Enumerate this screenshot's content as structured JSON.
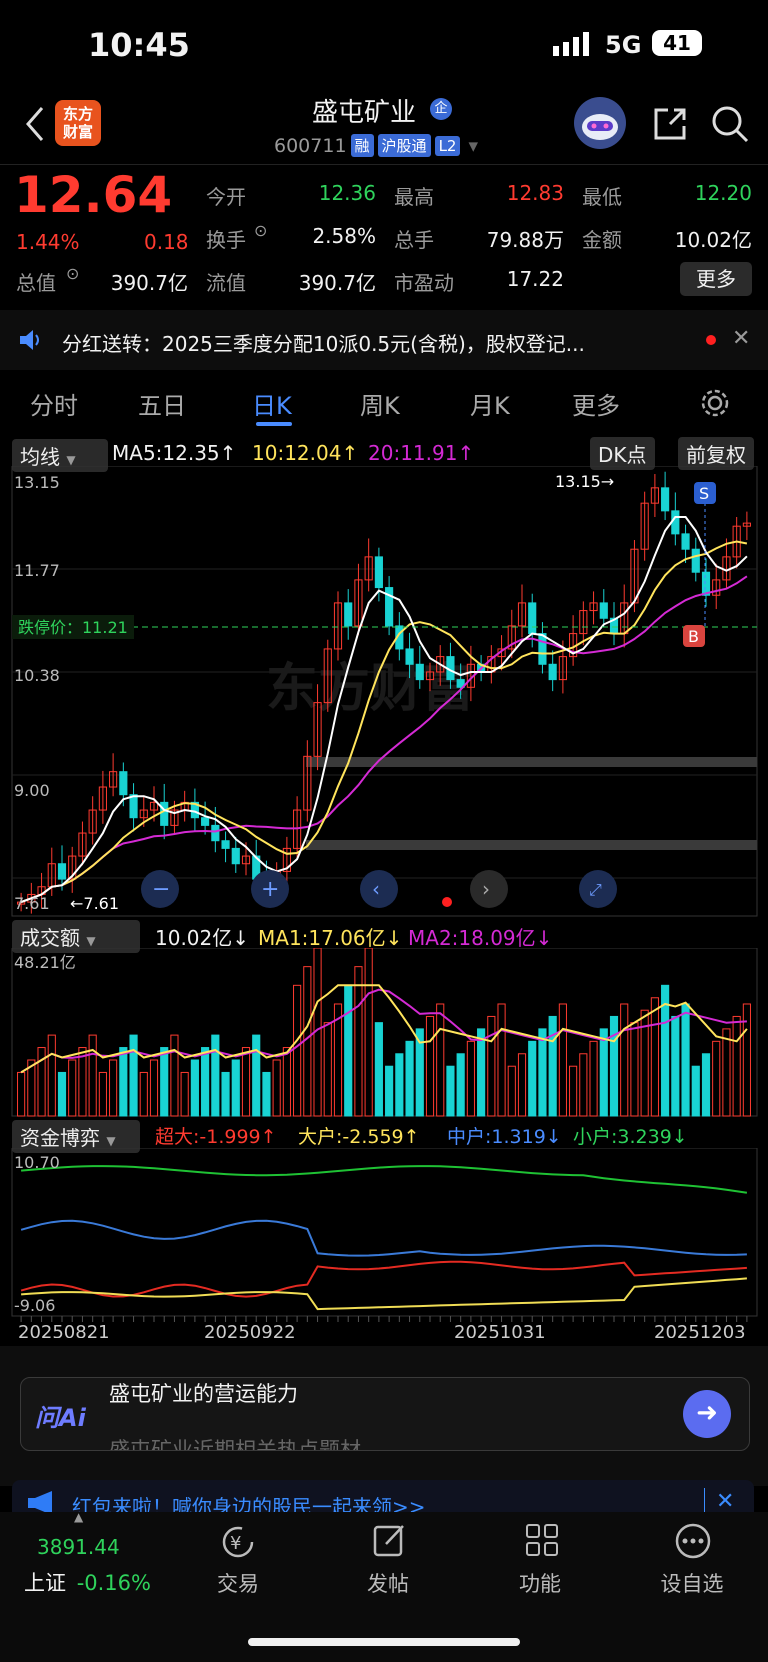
{
  "status_bar": {
    "time": "10:45",
    "network": "5G",
    "battery": "41"
  },
  "header": {
    "app_logo": "东方\n财富",
    "title": "盛屯矿业",
    "title_badge": "企",
    "code": "600711",
    "tags": [
      "融",
      "沪股通",
      "L2"
    ]
  },
  "quote": {
    "price": "12.64",
    "change_pct": "1.44%",
    "change": "0.18",
    "stats": [
      {
        "label": "今开",
        "value": "12.36",
        "color": "green"
      },
      {
        "label": "最高",
        "value": "12.83",
        "color": "red"
      },
      {
        "label": "最低",
        "value": "12.20",
        "color": "green"
      },
      {
        "label": "换手",
        "value": "2.58%",
        "color": "white"
      },
      {
        "label": "总手",
        "value": "79.88万",
        "color": "white"
      },
      {
        "label": "金额",
        "value": "10.02亿",
        "color": "white"
      },
      {
        "label": "总值",
        "value": "390.7亿",
        "color": "white"
      },
      {
        "label": "流值",
        "value": "390.7亿",
        "color": "white"
      },
      {
        "label": "市盈动",
        "value": "17.22",
        "color": "white"
      }
    ],
    "more_button": "更多"
  },
  "notice": {
    "text": "分红送转：2025三季度分配10派0.5元(含税)，股权登记..."
  },
  "tabs": [
    "分时",
    "五日",
    "日K",
    "周K",
    "月K",
    "更多"
  ],
  "active_tab": "日K",
  "kline": {
    "ma_selector": "均线",
    "ma5": "MA5:12.35↑",
    "ma10": "10:12.04↑",
    "ma20": "20:11.91↑",
    "dk_button": "DK点",
    "fq_button": "前复权",
    "y_labels": [
      "13.15",
      "11.77",
      "10.38",
      "9.00",
      "7.61"
    ],
    "limit_down": "跌停价：11.21",
    "high_mark": "13.15→",
    "low_mark": "←7.61",
    "signal_s": "S",
    "signal_b": "B",
    "watermark": "东方财富"
  },
  "volume": {
    "selector": "成交额",
    "current": "10.02亿↓",
    "ma1": "MA1:17.06亿↓",
    "ma2": "MA2:18.09亿↓",
    "max_label": "48.21亿"
  },
  "capital": {
    "selector": "资金博弈",
    "super": "超大:-1.999↑",
    "large": "大户:-2.559↑",
    "mid": "中户:1.319↓",
    "small": "小户:3.239↓",
    "y_top": "10.70",
    "y_bottom": "-9.06",
    "dates": [
      "20250821",
      "20250922",
      "20251031",
      "20251203"
    ]
  },
  "ai": {
    "logo": "问Ai",
    "prompt": "盛屯矿业的营运能力",
    "prompt2": "盛屯矿业近期相关热点题材"
  },
  "banner": {
    "text": "红包来啦！喊你身边的股民一起来领>>"
  },
  "bottom_nav": {
    "index_value": "3891.44",
    "index_name": "上证",
    "index_change": "-0.16%",
    "items": [
      "交易",
      "发帖",
      "功能",
      "设自选"
    ]
  },
  "colors": {
    "up": "#ff3b30",
    "down": "#2fd35c",
    "candle_down": "#19d3d3",
    "ma5": "#ffffff",
    "ma10": "#ffe45c",
    "ma20": "#d42ad4",
    "accent": "#4a8cff"
  }
}
